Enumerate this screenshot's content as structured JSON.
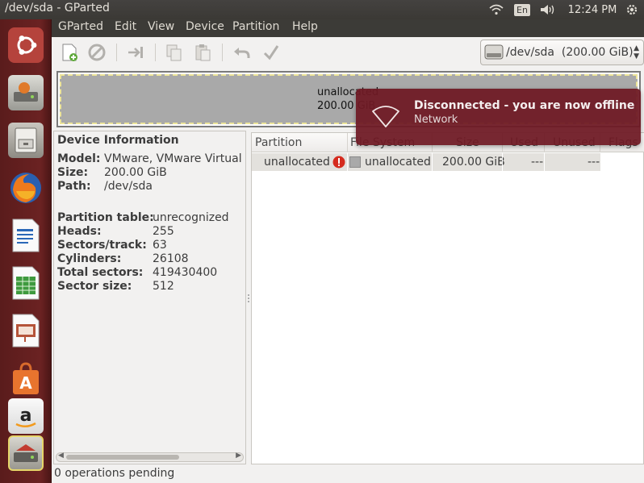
{
  "topbar": {
    "window_title": "/dev/sda - GParted",
    "lang": "En",
    "clock": "12:24 PM"
  },
  "launcher": {
    "items": [
      {
        "name": "dash-home",
        "icon": "ubuntu-logo-icon"
      },
      {
        "name": "gparted-installer",
        "icon": "disk-installer-icon"
      },
      {
        "name": "files",
        "icon": "file-cabinet-icon"
      },
      {
        "name": "firefox",
        "icon": "firefox-icon"
      },
      {
        "name": "libreoffice-writer",
        "icon": "writer-icon"
      },
      {
        "name": "libreoffice-calc",
        "icon": "calc-icon"
      },
      {
        "name": "libreoffice-impress",
        "icon": "impress-icon"
      },
      {
        "name": "software-center",
        "icon": "shopping-bag-icon"
      },
      {
        "name": "amazon",
        "icon": "amazon-icon"
      },
      {
        "name": "gparted",
        "icon": "gparted-icon"
      }
    ],
    "colors": {
      "launcher_bg": "#6b2222"
    }
  },
  "menubar": {
    "items": [
      "GParted",
      "Edit",
      "View",
      "Device",
      "Partition",
      "Help"
    ]
  },
  "toolbar": {
    "buttons": [
      "new-partition-icon",
      "delete-icon",
      "resize-move-icon",
      "copy-icon",
      "paste-icon",
      "undo-icon",
      "apply-icon"
    ],
    "device_selector": "/dev/sda  (200.00 GiB)"
  },
  "diskmap": {
    "label": "unallocated",
    "size": "200.00 GiB"
  },
  "device_info": {
    "header": "Device Information",
    "model_key": "Model:",
    "model_val": "VMware, VMware Virtual S",
    "size_key": "Size:",
    "size_val": "200.00 GiB",
    "path_key": "Path:",
    "path_val": "/dev/sda",
    "ptable_key": "Partition table:",
    "ptable_val": "unrecognized",
    "heads_key": "Heads:",
    "heads_val": "255",
    "sectors_track_key": "Sectors/track:",
    "sectors_track_val": "63",
    "cylinders_key": "Cylinders:",
    "cylinders_val": "26108",
    "total_sectors_key": "Total sectors:",
    "total_sectors_val": "419430400",
    "sector_size_key": "Sector size:",
    "sector_size_val": "512"
  },
  "partition_table": {
    "columns": [
      "Partition",
      "File System",
      "Size",
      "Used",
      "Unused",
      "Flags"
    ],
    "rows": [
      {
        "partition": "unallocated",
        "filesystem": "unallocated",
        "size": "200.00 GiB",
        "used": "---",
        "unused": "---",
        "flags": ""
      }
    ]
  },
  "statusbar": {
    "text": "0 operations pending"
  },
  "notification": {
    "title": "Disconnected - you are now offline",
    "body": "Network",
    "icon": "wifi-disconnected-icon",
    "color": "#6e1a24"
  }
}
